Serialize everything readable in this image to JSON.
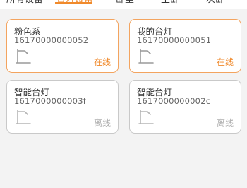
{
  "tabs": [
    {
      "label": "所有设备"
    },
    {
      "label": "台灯设备"
    },
    {
      "label": "卧室"
    },
    {
      "label": "主卧"
    },
    {
      "label": "次卧"
    }
  ],
  "active_tab_index": 1,
  "devices": [
    {
      "name": "粉色系",
      "sn": "16170000000052",
      "status": "在线",
      "icon": "desk-lamp-icon"
    },
    {
      "name": "我的台灯",
      "sn": "16170000000051",
      "status": "在线",
      "icon": "desk-lamp-icon"
    },
    {
      "name": "智能台灯",
      "sn": "1617000000003f",
      "status": "离线",
      "icon": "desk-lamp-icon"
    },
    {
      "name": "智能台灯",
      "sn": "1617000000002c",
      "status": "离线",
      "icon": "desk-lamp-icon"
    }
  ],
  "colors": {
    "accent": "#f08a2c",
    "online_border": "#f3a45f",
    "offline_border": "#c9c9c9",
    "offline_text": "#b0b0b0"
  }
}
